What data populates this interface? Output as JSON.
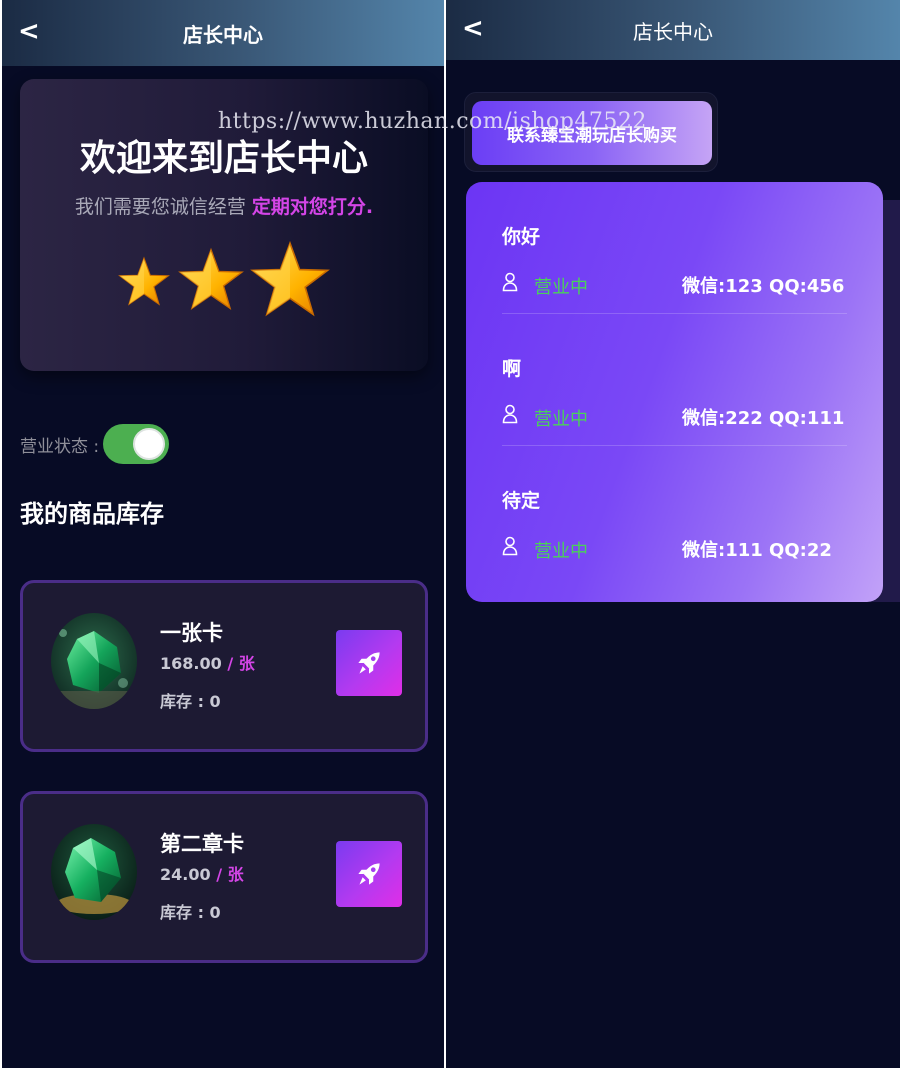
{
  "left": {
    "header": {
      "back": "<",
      "title": "店长中心"
    },
    "welcome": {
      "title": "欢迎来到店长中心",
      "subtitle": "我们需要您诚信经营",
      "highlight": "定期对您打分.",
      "star_count": 3
    },
    "status": {
      "label": "营业状态 :",
      "enabled": true
    },
    "section_title": "我的商品库存",
    "products": [
      {
        "name": "一张卡",
        "price": "168.00",
        "unit": "/ 张",
        "stock": "库存 : 0",
        "image": "green-gem-image"
      },
      {
        "name": "第二章卡",
        "price": "24.00",
        "unit": "/ 张",
        "stock": "库存 : 0",
        "image": "green-gem-image"
      }
    ]
  },
  "right": {
    "header": {
      "back": "<",
      "title": "店长中心"
    },
    "contact_button": "联系臻宝潮玩店长购买",
    "shops": [
      {
        "name": "你好",
        "status": "营业中",
        "contact": "微信:123  QQ:456"
      },
      {
        "name": "啊",
        "status": "营业中",
        "contact": "微信:222  QQ:111"
      },
      {
        "name": "待定",
        "status": "营业中",
        "contact": "微信:111  QQ:22"
      }
    ]
  },
  "watermark": "https://www.huzhan.com/ishop47522",
  "colors": {
    "accent_pink": "#d445e7",
    "status_green": "#4bd05a",
    "toggle_green": "#4caf50",
    "bg": "#070b25"
  }
}
